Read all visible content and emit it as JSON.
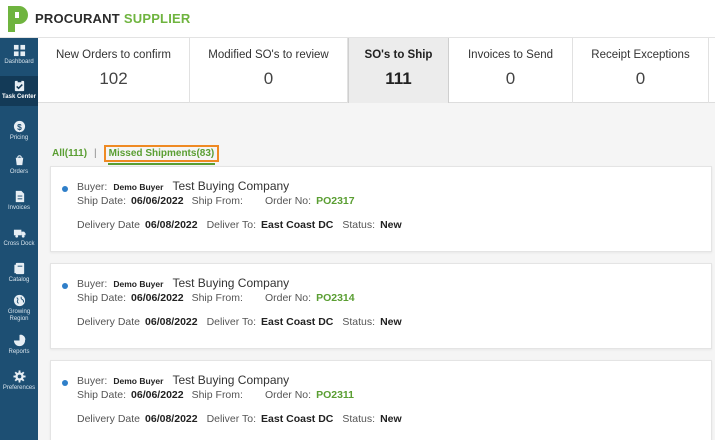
{
  "app": {
    "brand_primary": "PROCURANT",
    "brand_secondary": "SUPPLIER",
    "logo_letter": "P"
  },
  "colors": {
    "sidebar": "#1d4f73",
    "accent_green": "#5a9e32",
    "highlight_orange": "#ef8a23",
    "dot_blue": "#2f7fc9"
  },
  "sidebar": {
    "items": [
      {
        "label": "Dashboard",
        "icon": "dashboard-icon"
      },
      {
        "label": "Task Center",
        "icon": "clipboard-icon",
        "active": true
      },
      {
        "label": "Pricing",
        "icon": "dollar-icon"
      },
      {
        "label": "Orders",
        "icon": "orders-icon"
      },
      {
        "label": "Invoices",
        "icon": "invoice-icon"
      },
      {
        "label": "Cross Dock",
        "icon": "truck-icon"
      },
      {
        "label": "Catalog",
        "icon": "catalog-icon"
      },
      {
        "label": "Growing Region",
        "icon": "globe-icon"
      },
      {
        "label": "Reports",
        "icon": "pie-chart-icon"
      },
      {
        "label": "Preferences",
        "icon": "gear-icon"
      }
    ]
  },
  "tabs": [
    {
      "title": "New Orders to confirm",
      "count": "102"
    },
    {
      "title": "Modified SO's to review",
      "count": "0"
    },
    {
      "title": "SO's to Ship",
      "count": "111",
      "active": true
    },
    {
      "title": "Invoices to Send",
      "count": "0"
    },
    {
      "title": "Receipt Exceptions",
      "count": "0"
    }
  ],
  "filters": {
    "all": "All(111)",
    "separator": "|",
    "missed": "Missed Shipments(83)"
  },
  "labels": {
    "buyer": "Buyer:",
    "ship_date": "Ship Date:",
    "ship_from": "Ship From:",
    "order_no": "Order No:",
    "delivery_date": "Delivery Date",
    "deliver_to": "Deliver To:",
    "status": "Status:"
  },
  "orders": [
    {
      "buyer": "Demo Buyer",
      "company": "Test Buying Company",
      "ship_date": "06/06/2022",
      "order_no": "PO2317",
      "delivery_date": "06/08/2022",
      "deliver_to": "East Coast DC",
      "status": "New"
    },
    {
      "buyer": "Demo Buyer",
      "company": "Test Buying Company",
      "ship_date": "06/06/2022",
      "order_no": "PO2314",
      "delivery_date": "06/08/2022",
      "deliver_to": "East Coast DC",
      "status": "New"
    },
    {
      "buyer": "Demo Buyer",
      "company": "Test Buying Company",
      "ship_date": "06/06/2022",
      "order_no": "PO2311",
      "delivery_date": "06/08/2022",
      "deliver_to": "East Coast DC",
      "status": "New"
    }
  ]
}
